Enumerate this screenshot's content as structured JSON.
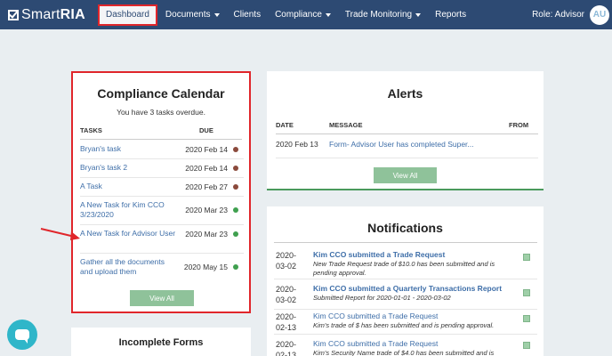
{
  "nav": {
    "brand_light": "Smart",
    "brand_bold": "RIA",
    "items": [
      {
        "label": "Dashboard"
      },
      {
        "label": "Documents"
      },
      {
        "label": "Clients"
      },
      {
        "label": "Compliance"
      },
      {
        "label": "Trade Monitoring"
      },
      {
        "label": "Reports"
      }
    ],
    "role": "Role: Advisor",
    "avatar": "AU"
  },
  "calendar": {
    "title": "Compliance Calendar",
    "subtitle": "You have 3 tasks overdue.",
    "col_tasks": "TASKS",
    "col_due": "DUE",
    "tasks": [
      {
        "name": "Bryan's task",
        "due": "2020 Feb 14",
        "status_color": "#8b4a3c"
      },
      {
        "name": "Bryan's task 2",
        "due": "2020 Feb 14",
        "status_color": "#8b4a3c"
      },
      {
        "name": "A Task",
        "due": "2020 Feb 27",
        "status_color": "#8b4a3c"
      },
      {
        "name": "A New Task for Kim CCO 3/23/2020",
        "due": "2020 Mar 23",
        "status_color": "#3fa04f"
      },
      {
        "name": "A New Task for Advisor User",
        "due": "2020 Mar 23",
        "status_color": "#3fa04f"
      },
      {
        "name": "Gather all the documents and upload them",
        "due": "2020 May 15",
        "status_color": "#3fa04f"
      }
    ],
    "button": "View All"
  },
  "alerts": {
    "title": "Alerts",
    "col_date": "DATE",
    "col_message": "MESSAGE",
    "col_from": "FROM",
    "row": {
      "date": "2020 Feb 13",
      "message": "Form- Advisor User has completed Super..."
    },
    "button": "View All"
  },
  "notifications": {
    "title": "Notifications",
    "items": [
      {
        "date": "2020-03-02",
        "title": "Kim CCO submitted a Trade Request",
        "body": "New Trade Request trade of $10.0 has been submitted and is pending approval."
      },
      {
        "date": "2020-03-02",
        "title": "Kim CCO submitted a Quarterly Transactions Report",
        "body": "Submitted Report for 2020-01-01 - 2020-03-02"
      },
      {
        "date": "2020-02-13",
        "title": "Kim CCO submitted a Trade Request",
        "body": "Kim's trade of $ has been submitted and is pending approval."
      },
      {
        "date": "2020-02-13",
        "title": "Kim CCO submitted a Trade Request",
        "body": "Kim's Security Name trade of $4.0 has been submitted and is"
      }
    ]
  },
  "forms": {
    "title": "Incomplete Forms"
  },
  "colors": {
    "navbar": "#2d4a73",
    "highlight": "#e0262b",
    "button": "#8fc29a",
    "link": "#3e6ea8"
  }
}
